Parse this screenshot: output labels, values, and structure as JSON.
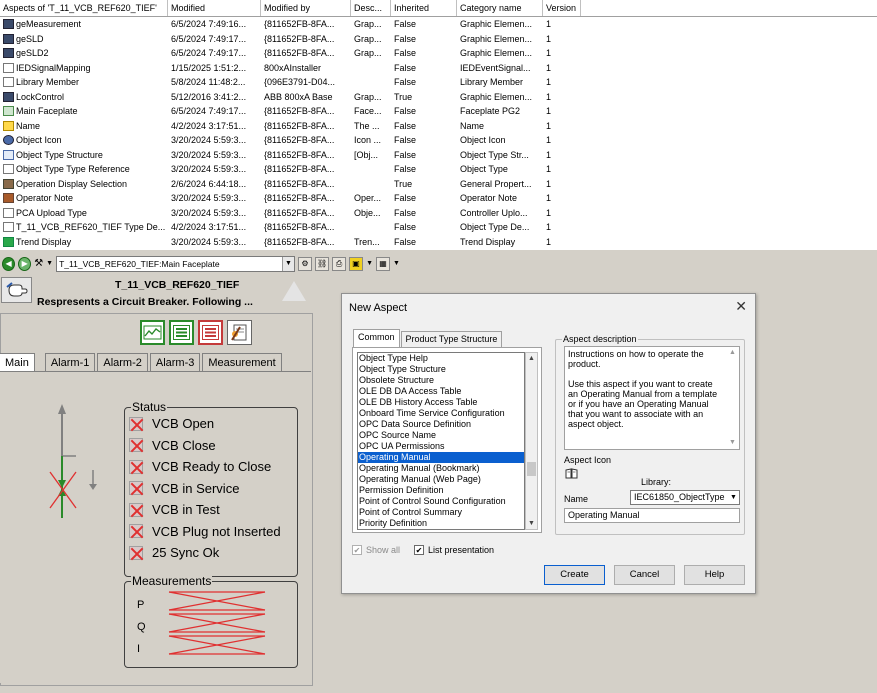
{
  "table": {
    "headers": [
      "Aspects of 'T_11_VCB_REF620_TIEF'",
      "Modified",
      "Modified by",
      "Desc...",
      "Inherited",
      "Category name",
      "Version"
    ],
    "rows": [
      {
        "icon": "graphic",
        "name": "geMeasurement",
        "modified": "6/5/2024 7:49:16...",
        "by": "{811652FB-8FA...",
        "desc": "Grap...",
        "inherited": "False",
        "category": "Graphic Elemen...",
        "version": "1"
      },
      {
        "icon": "graphic",
        "name": "geSLD",
        "modified": "6/5/2024 7:49:17...",
        "by": "{811652FB-8FA...",
        "desc": "Grap...",
        "inherited": "False",
        "category": "Graphic Elemen...",
        "version": "1"
      },
      {
        "icon": "graphic",
        "name": "geSLD2",
        "modified": "6/5/2024 7:49:17...",
        "by": "{811652FB-8FA...",
        "desc": "Grap...",
        "inherited": "False",
        "category": "Graphic Elemen...",
        "version": "1"
      },
      {
        "icon": "blank",
        "name": "IEDSignalMapping",
        "modified": "1/15/2025 1:51:2...",
        "by": "800xAInstaller",
        "desc": "",
        "inherited": "False",
        "category": "IEDEventSignal...",
        "version": "1"
      },
      {
        "icon": "blank",
        "name": "Library Member",
        "modified": "5/8/2024 11:48:2...",
        "by": "{096E3791-D04...",
        "desc": "",
        "inherited": "False",
        "category": "Library Member",
        "version": "1"
      },
      {
        "icon": "graphic",
        "name": "LockControl",
        "modified": "5/12/2016 3:41:2...",
        "by": "ABB 800xA Base",
        "desc": "Grap...",
        "inherited": "True",
        "category": "Graphic Elemen...",
        "version": "1"
      },
      {
        "icon": "face",
        "name": "Main Faceplate",
        "modified": "6/5/2024 7:49:17...",
        "by": "{811652FB-8FA...",
        "desc": "Face...",
        "inherited": "False",
        "category": "Faceplate PG2",
        "version": "1"
      },
      {
        "icon": "name",
        "name": "Name",
        "modified": "4/2/2024 3:17:51...",
        "by": "{811652FB-8FA...",
        "desc": "The ...",
        "inherited": "False",
        "category": "Name",
        "version": "1"
      },
      {
        "icon": "obj",
        "name": "Object Icon",
        "modified": "3/20/2024 5:59:3...",
        "by": "{811652FB-8FA...",
        "desc": "Icon ...",
        "inherited": "False",
        "category": "Object Icon",
        "version": "1"
      },
      {
        "icon": "struct",
        "name": "Object Type Structure",
        "modified": "3/20/2024 5:59:3...",
        "by": "{811652FB-8FA...",
        "desc": "[Obj...",
        "inherited": "False",
        "category": "Object Type Str...",
        "version": "1"
      },
      {
        "icon": "blank",
        "name": "Object Type Type Reference",
        "modified": "3/20/2024 5:59:3...",
        "by": "{811652FB-8FA...",
        "desc": "",
        "inherited": "False",
        "category": "Object Type",
        "version": "1"
      },
      {
        "icon": "opsel",
        "name": "Operation Display Selection",
        "modified": "2/6/2024 6:44:18...",
        "by": "{811652FB-8FA...",
        "desc": "",
        "inherited": "True",
        "category": "General Propert...",
        "version": "1"
      },
      {
        "icon": "note",
        "name": "Operator Note",
        "modified": "3/20/2024 5:59:3...",
        "by": "{811652FB-8FA...",
        "desc": "Oper...",
        "inherited": "False",
        "category": "Operator Note",
        "version": "1"
      },
      {
        "icon": "blank",
        "name": "PCA Upload Type",
        "modified": "3/20/2024 5:59:3...",
        "by": "{811652FB-8FA...",
        "desc": "Obje...",
        "inherited": "False",
        "category": "Controller Uplo...",
        "version": "1"
      },
      {
        "icon": "blank",
        "name": "T_11_VCB_REF620_TIEF Type De...",
        "modified": "4/2/2024 3:17:51...",
        "by": "{811652FB-8FA...",
        "desc": "",
        "inherited": "False",
        "category": "Object Type De...",
        "version": "1"
      },
      {
        "icon": "trend",
        "name": "Trend Display",
        "modified": "3/20/2024 5:59:3...",
        "by": "{811652FB-8FA...",
        "desc": "Tren...",
        "inherited": "False",
        "category": "Trend Display",
        "version": "1"
      }
    ]
  },
  "toolbar": {
    "combo_value": "T_11_VCB_REF620_TIEF:Main Faceplate",
    "icons": [
      "back-icon",
      "forward-icon",
      "tools-icon",
      "dropdown-icon",
      "combo-dropdown-icon",
      "tree-icon",
      "link-icon",
      "print-icon",
      "window-icon",
      "grid-icon"
    ]
  },
  "faceplate": {
    "title": "T_11_VCB_REF620_TIEF",
    "description": "Respresents a Circuit Breaker. Following ...",
    "tabs": [
      "Main",
      "Alarm-1",
      "Alarm-2",
      "Alarm-3",
      "Measurement"
    ],
    "status_group_title": "Status",
    "status_items": [
      "VCB Open",
      "VCB Close",
      "VCB Ready to Close",
      "VCB in Service",
      "VCB in Test",
      "VCB Plug not Inserted",
      "25 Sync Ok"
    ],
    "measurements_group_title": "Measurements",
    "measurement_labels": [
      "P",
      "Q",
      "I"
    ]
  },
  "dialog": {
    "title": "New Aspect",
    "close": "✕",
    "tabs": [
      "Common",
      "Product Type Structure"
    ],
    "list_items": [
      "Object Type Help",
      "Object Type Structure",
      "Obsolete Structure",
      "OLE DB DA Access Table",
      "OLE DB History Access Table",
      "Onboard Time Service Configuration",
      "OPC Data Source Definition",
      "OPC Source Name",
      "OPC UA Permissions",
      "Operating Manual",
      "Operating Manual (Bookmark)",
      "Operating Manual (Web Page)",
      "Permission Definition",
      "Point of Control Sound Configuration",
      "Point of Control Summary",
      "Priority Definition"
    ],
    "selected_item": "Operating Manual",
    "description_group_title": "Aspect description",
    "description_p1": "Instructions on how to operate the product.",
    "description_p2": "Use this aspect if you want to create an Operating Manual from a template or if you have an Operating Manual that you want to associate with an aspect object.",
    "aspect_icon_label": "Aspect Icon",
    "library_label": "Library:",
    "library_value": "IEC61850_ObjectType",
    "name_label": "Name",
    "name_value": "Operating Manual",
    "show_all_label": "Show all",
    "show_all_checked": true,
    "list_presentation_label": "List presentation",
    "list_presentation_checked": true,
    "buttons": {
      "create": "Create",
      "cancel": "Cancel",
      "help": "Help"
    }
  },
  "colors": {
    "selection": "#0a5fcf",
    "status_x": "#e03030",
    "background": "#d4d0c8",
    "accent_green": "#2a8a2a"
  }
}
